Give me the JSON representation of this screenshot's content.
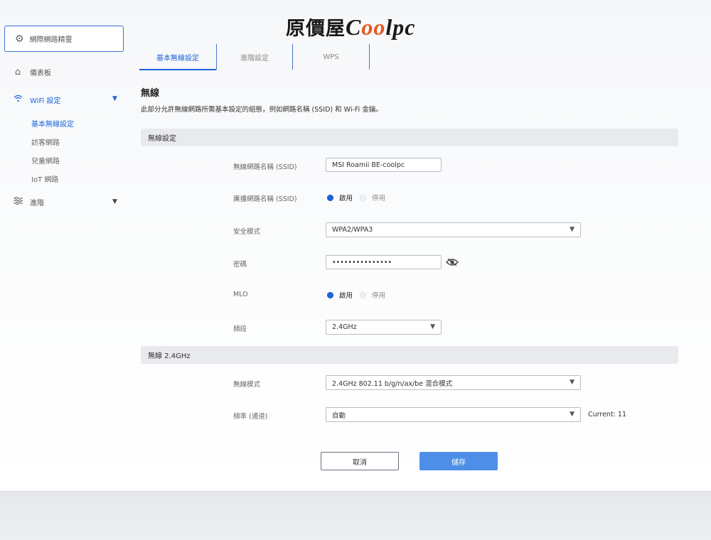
{
  "logo": {
    "chinese": "原價屋",
    "brand_pre": "C",
    "brand_oo": "oo",
    "brand_post": "lpc"
  },
  "sidebar": {
    "wizard": {
      "label": "網際網路精靈",
      "icon": "gear-icon"
    },
    "dashboard": {
      "label": "儀表板",
      "icon": "home-icon"
    },
    "wifi": {
      "label": "WiFi 設定",
      "icon": "wifi-icon"
    },
    "wifi_items": [
      "基本無線設定",
      "訪客網路",
      "兒童網路",
      "IoT 網路"
    ],
    "advanced": {
      "label": "進階",
      "icon": "sliders-icon"
    }
  },
  "tabs": [
    "基本無線設定",
    "進階設定",
    "WPS"
  ],
  "section": {
    "title": "無線",
    "desc": "此部分允許無線網路所需基本設定的組態，例如網路名稱 (SSID) 和 Wi-Fi 金鑰。"
  },
  "wireless_settings": {
    "header": "無線設定",
    "ssid_label": "無線網路名稱 (SSID)",
    "ssid_value": "MSI Roamii BE-coolpc",
    "broadcast_label": "廣播網路名稱 (SSID)",
    "broadcast_on": "啟用",
    "broadcast_off": "停用",
    "security_label": "安全模式",
    "security_value": "WPA2/WPA3",
    "password_label": "密碼",
    "password_value": "•••••••••••••••",
    "mlo_label": "MLO",
    "mlo_on": "啟用",
    "mlo_off": "停用",
    "band_label": "頻段",
    "band_value": "2.4GHz"
  },
  "wireless_24": {
    "header": "無線 2.4GHz",
    "mode_label": "無線模式",
    "mode_value": "2.4GHz 802.11 b/g/n/ax/be 混合模式",
    "channel_label": "頻率 (通道)",
    "channel_value": "自動",
    "current": "Current: 11"
  },
  "buttons": {
    "cancel": "取消",
    "save": "儲存"
  }
}
